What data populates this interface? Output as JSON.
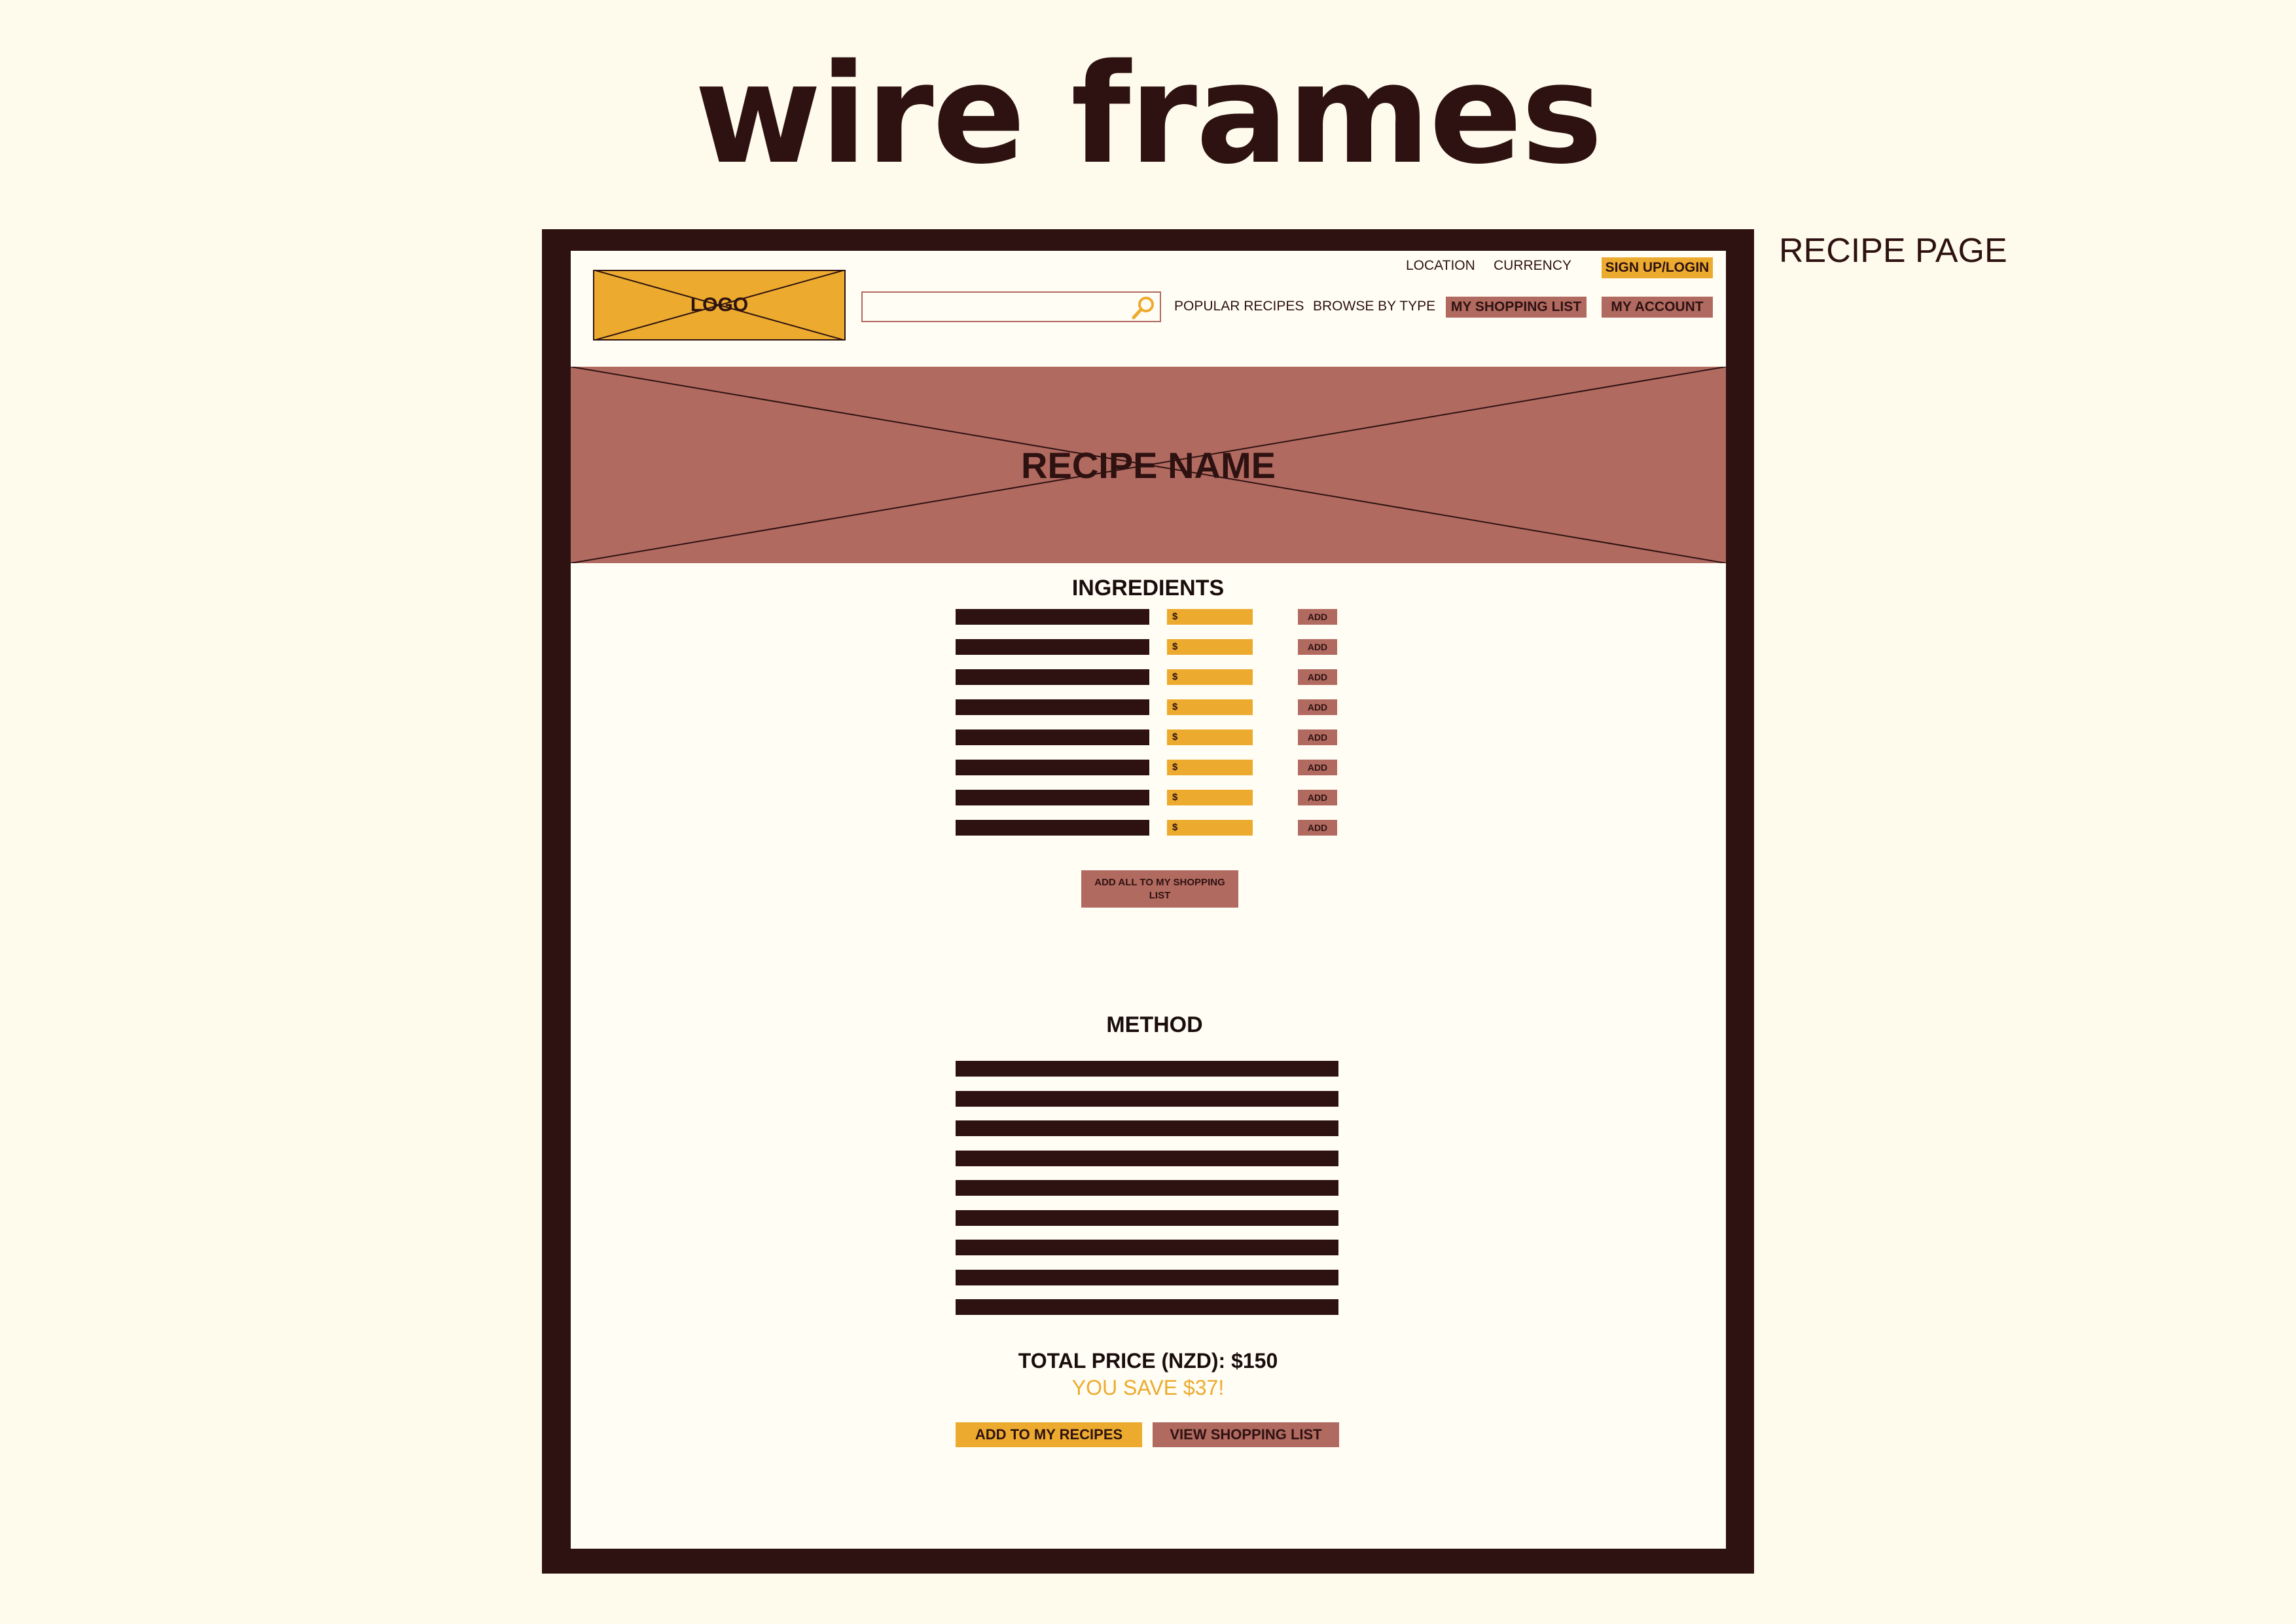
{
  "page": {
    "heading": "wire frames",
    "side_label": "RECIPE PAGE"
  },
  "header": {
    "logo_text": "LOGO",
    "search_placeholder": "",
    "top_links": [
      "LOCATION",
      "CURRENCY"
    ],
    "sign_up_label": "SIGN UP/LOGIN",
    "nav_links": [
      "POPULAR RECIPES",
      "BROWSE BY TYPE"
    ],
    "shopping_list_label": "MY SHOPPING LIST",
    "account_label": "MY ACCOUNT"
  },
  "hero": {
    "title": "RECIPE NAME"
  },
  "ingredients": {
    "title": "INGREDIENTS",
    "rows": [
      {
        "price": "$",
        "add": "ADD"
      },
      {
        "price": "$",
        "add": "ADD"
      },
      {
        "price": "$",
        "add": "ADD"
      },
      {
        "price": "$",
        "add": "ADD"
      },
      {
        "price": "$",
        "add": "ADD"
      },
      {
        "price": "$",
        "add": "ADD"
      },
      {
        "price": "$",
        "add": "ADD"
      },
      {
        "price": "$",
        "add": "ADD"
      }
    ],
    "add_all_label": "ADD ALL TO MY SHOPPING LIST"
  },
  "method": {
    "title": "METHOD",
    "line_count": 9
  },
  "summary": {
    "total_price": "TOTAL PRICE (NZD): $150",
    "savings": "YOU SAVE $37!",
    "add_recipes_label": "ADD TO MY RECIPES",
    "view_list_label": "VIEW SHOPPING LIST"
  },
  "colors": {
    "background": "#fefbec",
    "frame": "#2e1211",
    "accent_yellow": "#ecab2f",
    "accent_rose": "#b16a60"
  },
  "icons": {
    "search": "search-icon"
  }
}
